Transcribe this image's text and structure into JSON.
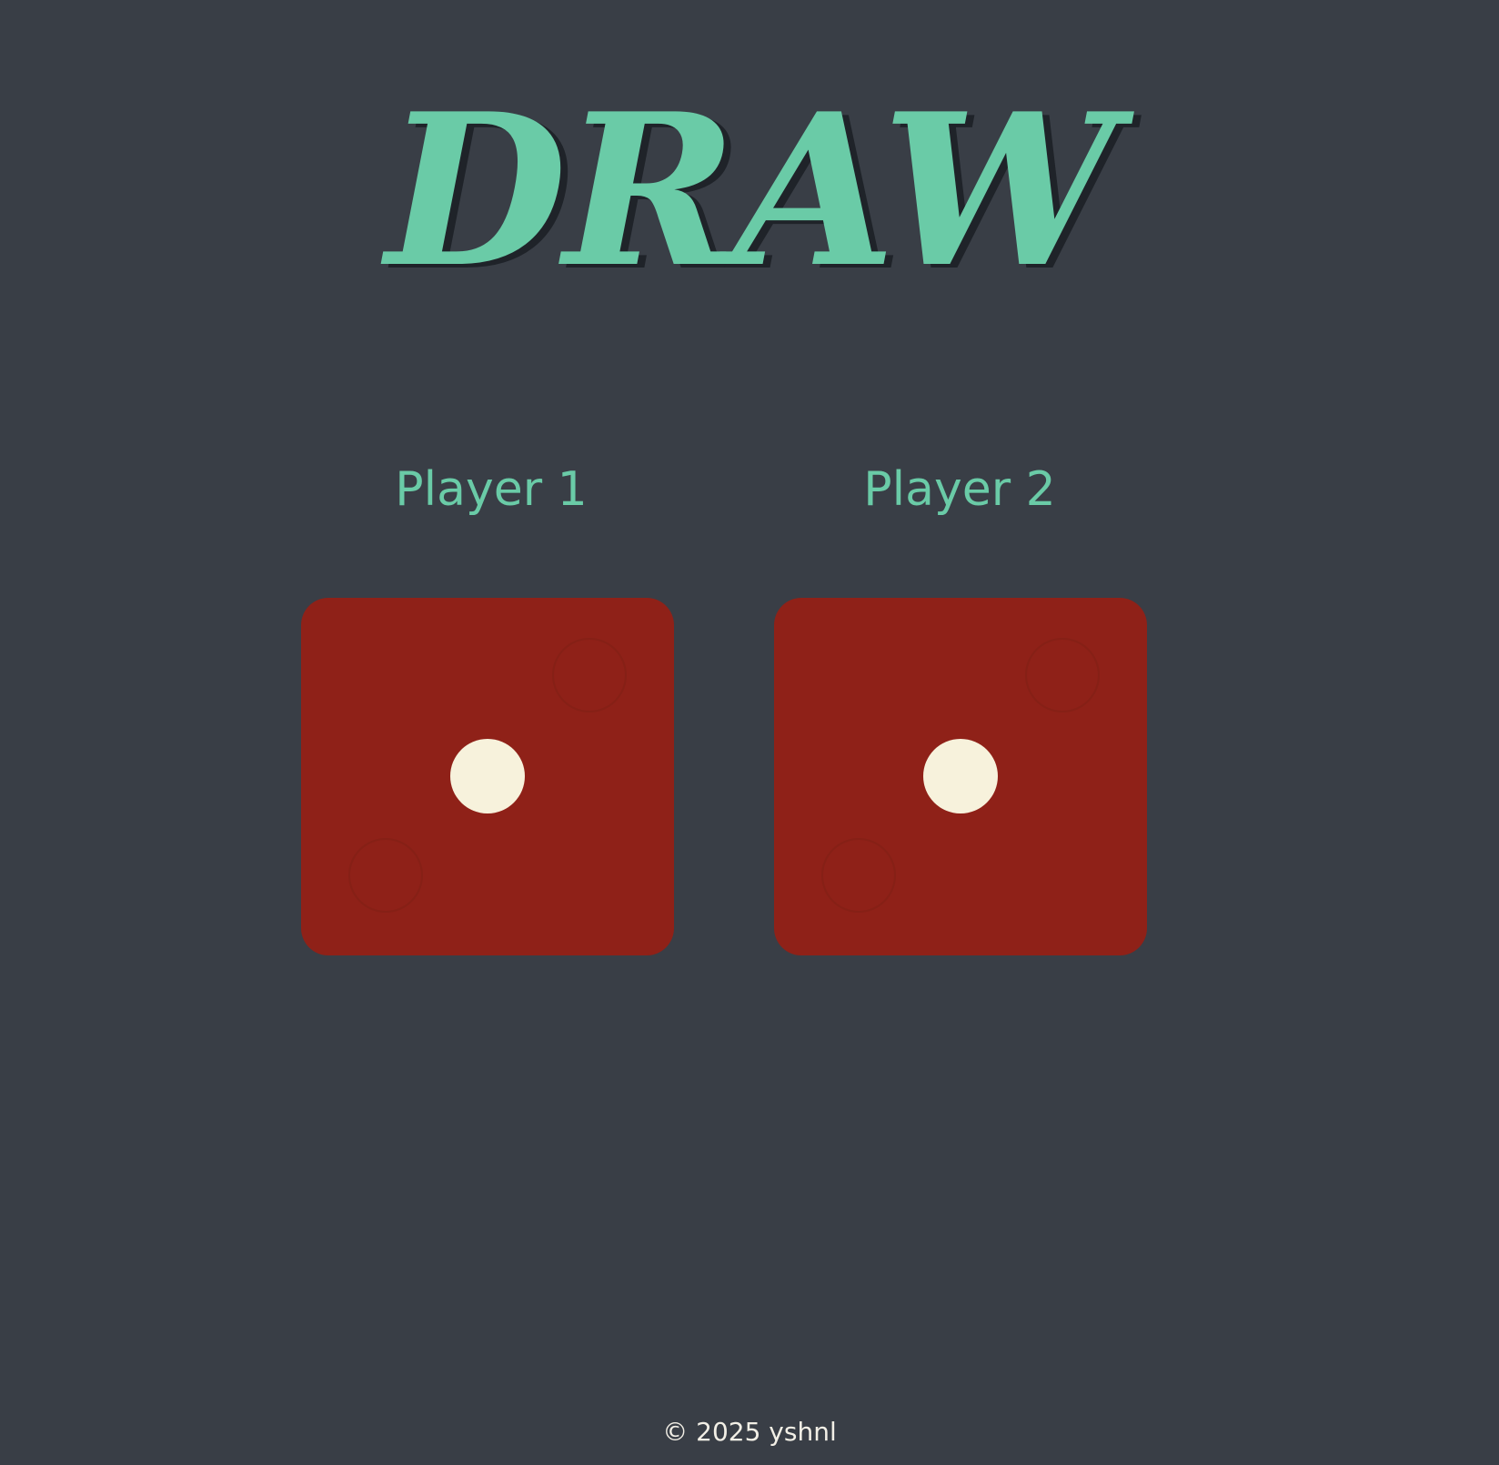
{
  "title": "DRAW",
  "players": [
    {
      "label": "Player 1",
      "die_value": 1
    },
    {
      "label": "Player 2",
      "die_value": 1
    }
  ],
  "footer": "© 2025 yshnl",
  "colors": {
    "background": "#393e46",
    "accent": "#6acba7",
    "die": "#8f2118",
    "pip": "#f7f2dc",
    "footer_text": "#f2efe6"
  }
}
